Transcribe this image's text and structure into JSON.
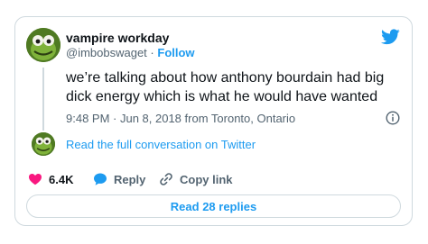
{
  "tweet": {
    "author": {
      "display_name": "vampire workday",
      "handle": "@imbobswaget",
      "separator": "·",
      "follow_label": "Follow",
      "avatar_icon": "frog-puppet-avatar-icon"
    },
    "text": "we’re talking about how anthony bourdain had big dick energy which is what he would have wanted",
    "timestamp": "9:48 PM · Jun 8, 2018 from Toronto, Ontario",
    "info_icon": "info-circle-icon",
    "platform_icon": "twitter-bird-icon",
    "conversation_link": "Read the full conversation on Twitter",
    "actions": {
      "like_count": "6.4K",
      "reply_label": "Reply",
      "copy_link_label": "Copy link"
    },
    "read_replies_label": "Read 28 replies"
  },
  "colors": {
    "accent": "#1d9bf0",
    "like": "#f91880",
    "muted_text": "#536471",
    "border": "#cfd9de"
  }
}
